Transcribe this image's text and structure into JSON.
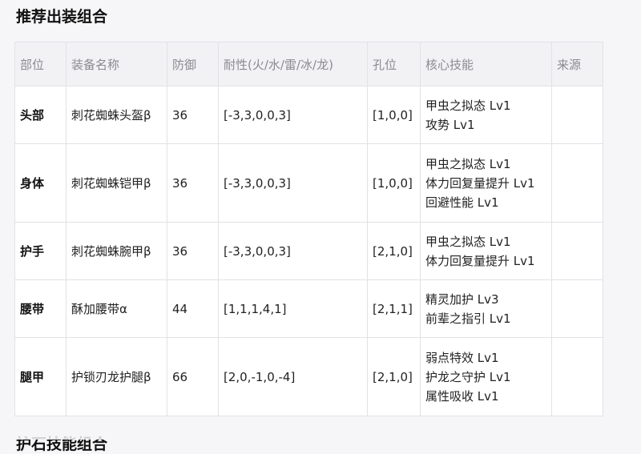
{
  "section_title": "推荐出装组合",
  "next_section_title": "护石技能组合",
  "table": {
    "headers": [
      "部位",
      "装备名称",
      "防御",
      "耐性(火/水/雷/冰/龙)",
      "孔位",
      "核心技能",
      "来源"
    ],
    "rows": [
      {
        "part": "头部",
        "name": "刺花蜘蛛头盔β",
        "defense": "36",
        "resist": "[-3,3,0,0,3]",
        "slots": "[1,0,0]",
        "skills": [
          "甲虫之拟态 Lv1",
          "攻势 Lv1"
        ],
        "source": ""
      },
      {
        "part": "身体",
        "name": "刺花蜘蛛铠甲β",
        "defense": "36",
        "resist": "[-3,3,0,0,3]",
        "slots": "[1,0,0]",
        "skills": [
          "甲虫之拟态 Lv1",
          "体力回复量提升 Lv1",
          "回避性能 Lv1"
        ],
        "source": ""
      },
      {
        "part": "护手",
        "name": "刺花蜘蛛腕甲β",
        "defense": "36",
        "resist": "[-3,3,0,0,3]",
        "slots": "[2,1,0]",
        "skills": [
          "甲虫之拟态 Lv1",
          "体力回复量提升 Lv1"
        ],
        "source": ""
      },
      {
        "part": "腰带",
        "name": "酥加腰带α",
        "defense": "44",
        "resist": "[1,1,1,4,1]",
        "slots": "[2,1,1]",
        "skills": [
          "精灵加护 Lv3",
          "前辈之指引 Lv1"
        ],
        "source": ""
      },
      {
        "part": "腿甲",
        "name": "护锁刃龙护腿β",
        "defense": "66",
        "resist": "[2,0,-1,0,-4]",
        "slots": "[2,1,0]",
        "skills": [
          "弱点特效 Lv1",
          "护龙之守护 Lv1",
          "属性吸收 Lv1"
        ],
        "source": ""
      }
    ]
  }
}
